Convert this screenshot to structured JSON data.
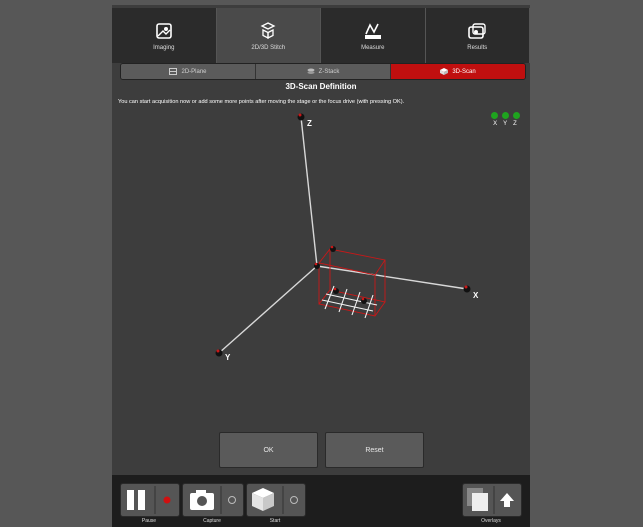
{
  "tabs": [
    {
      "label": "Imaging",
      "icon": "imaging-icon",
      "active": false
    },
    {
      "label": "2D/3D Stitch",
      "icon": "stitch-icon",
      "active": true
    },
    {
      "label": "Measure",
      "icon": "measure-icon",
      "active": false
    },
    {
      "label": "Results",
      "icon": "results-icon",
      "active": false
    }
  ],
  "modes": [
    {
      "label": "2D-Plane",
      "icon": "plane-icon",
      "active": false
    },
    {
      "label": "Z-Stack",
      "icon": "zstack-icon",
      "active": false
    },
    {
      "label": "3D-Scan",
      "icon": "cube-icon",
      "active": true
    }
  ],
  "section": {
    "title": "3D-Scan Definition",
    "instruction": "You can start acquisition now or add some more points after moving the stage or the focus drive (with pressing OK)."
  },
  "indicator": {
    "labels": [
      "X",
      "Y",
      "Z"
    ],
    "color": "#1fa31f"
  },
  "axes": {
    "x": "X",
    "y": "Y",
    "z": "Z"
  },
  "buttons": {
    "ok": "OK",
    "reset": "Reset"
  },
  "toolbar": {
    "pause": "Pause",
    "capture": "Capture",
    "start": "Start",
    "overlays": "Overlays"
  },
  "colors": {
    "accent": "#c00f0f",
    "indicator": "#1fa31f"
  }
}
